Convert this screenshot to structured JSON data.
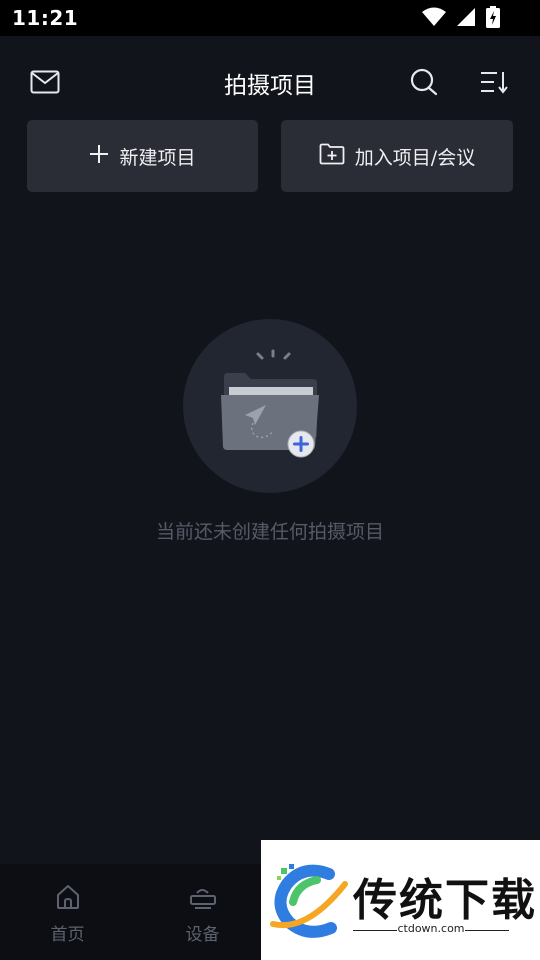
{
  "status_bar": {
    "time": "11:21",
    "icons": [
      "wifi-icon",
      "signal-icon",
      "battery-charging-icon"
    ]
  },
  "header": {
    "title": "拍摄项目",
    "left_icon": "mail-icon",
    "right_icons": [
      "search-icon",
      "sort-icon"
    ]
  },
  "actions": {
    "new_project": "新建项目",
    "join_project": "加入项目/会议"
  },
  "empty_state": {
    "icon": "folder-send-icon",
    "message": "当前还未创建任何拍摄项目"
  },
  "bottom_nav": {
    "items": [
      {
        "label": "首页",
        "icon": "home-icon"
      },
      {
        "label": "设备",
        "icon": "device-icon"
      }
    ]
  },
  "watermark": {
    "brand": "传统下载",
    "url": "ctdown.com"
  },
  "colors": {
    "background": "#12141c",
    "button_bg": "#2b2d36",
    "muted_text": "#555a66"
  }
}
